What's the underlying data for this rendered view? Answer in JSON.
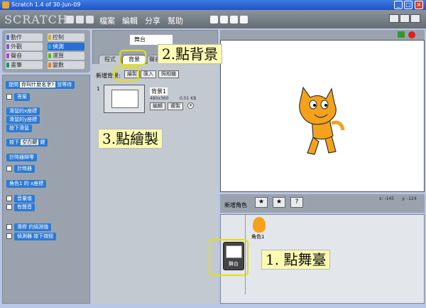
{
  "window": {
    "title": "Scratch 1.4 of 30-Jun-09"
  },
  "menubar": {
    "logo": "SCRATCH",
    "menus": [
      "檔案",
      "編輯",
      "分享",
      "幫助"
    ]
  },
  "categories": [
    {
      "label": "動作",
      "color": "#4a6cd4",
      "selected": false
    },
    {
      "label": "控制",
      "color": "#e1a91a",
      "selected": false
    },
    {
      "label": "外觀",
      "color": "#8a55d7",
      "selected": false
    },
    {
      "label": "偵測",
      "color": "#2ca5e2",
      "selected": true
    },
    {
      "label": "聲音",
      "color": "#bb42c3",
      "selected": false
    },
    {
      "label": "運算",
      "color": "#5cb712",
      "selected": false
    },
    {
      "label": "畫筆",
      "color": "#0e9a6c",
      "selected": false
    },
    {
      "label": "變數",
      "color": "#ee7d16",
      "selected": false
    }
  ],
  "palette": {
    "ask": "提問",
    "ask_input": "你叫什麼名字?",
    "ask_wait": "並等待",
    "answer": "答案",
    "mouse_x": "滑鼠的x座標",
    "mouse_y": "滑鼠的y座標",
    "mouse_down": "按下滑鼠",
    "key_prefix": "按下",
    "key_value": "空白鍵",
    "key_suffix": "鍵",
    "timer_reset": "計時器歸零",
    "timer": "計時器",
    "sprite_attr_a": "角色1",
    "sprite_attr_b": "的",
    "sprite_attr_c": "x座標",
    "loudness": "音量值",
    "loud": "有聲音",
    "sensor_value": "滑桿",
    "sensor_of": "的偵測值",
    "sensor_pressed": "偵測器",
    "sensor_button": "按下按鈕"
  },
  "middle": {
    "object_name": "舞台",
    "tabs": [
      "程式",
      "背景",
      "聲音"
    ],
    "new_background_label": "新增背景:",
    "buttons": [
      "繪製",
      "匯入",
      "照相機"
    ],
    "costume_index": "1",
    "costume_name": "背景1",
    "costume_size": "480x360",
    "costume_kb": "0.01 KB",
    "edit": "編輯",
    "copy": "複製"
  },
  "stage": {
    "coords_x": "x: -145",
    "coords_y": "y: -124"
  },
  "sprites": {
    "new_sprite_label": "新增角色",
    "sprite_name": "角色1",
    "stage_label": "舞台"
  },
  "callouts": {
    "step1": "1. 點舞臺",
    "step2": "2.點背景",
    "step3": "3.點繪製"
  },
  "highlight_color": "#e6e000"
}
